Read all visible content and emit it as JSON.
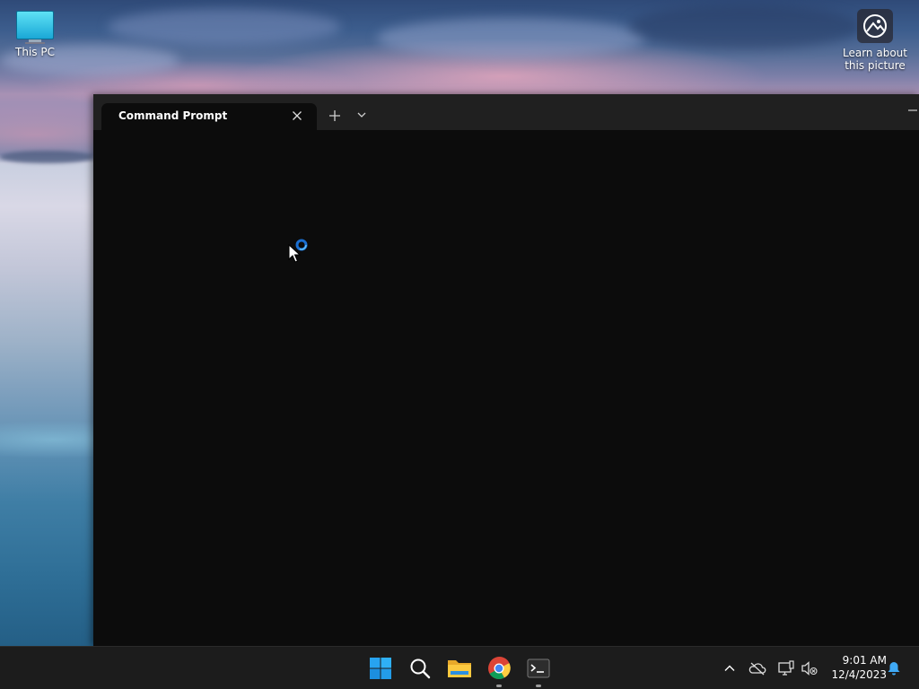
{
  "desktop": {
    "icons": [
      {
        "label": "This PC"
      },
      {
        "label": "Learn about this picture"
      }
    ]
  },
  "terminal": {
    "tab_title": "Command Prompt",
    "new_tab_icon": "plus-icon",
    "dropdown_icon": "chevron-down-icon",
    "close_icon": "close-icon",
    "minimize_icon": "minimize-icon"
  },
  "taskbar": {
    "apps": [
      {
        "name": "Start",
        "icon": "windows-logo-icon"
      },
      {
        "name": "Search",
        "icon": "search-icon"
      },
      {
        "name": "File Explorer",
        "icon": "folder-icon"
      },
      {
        "name": "Google Chrome",
        "icon": "chrome-icon"
      },
      {
        "name": "Terminal",
        "icon": "terminal-icon"
      }
    ],
    "tray": {
      "icons": [
        "chevron-up-icon",
        "onedrive-offline-icon",
        "network-icon",
        "volume-muted-icon",
        "notification-bell-icon"
      ]
    },
    "time": "9:01 AM",
    "date": "12/4/2023"
  },
  "colors": {
    "terminal_bg": "#0c0c0c",
    "titlebar_bg": "#202020",
    "taskbar_bg": "#1c1c1c",
    "accent": "#3fa9f5"
  }
}
